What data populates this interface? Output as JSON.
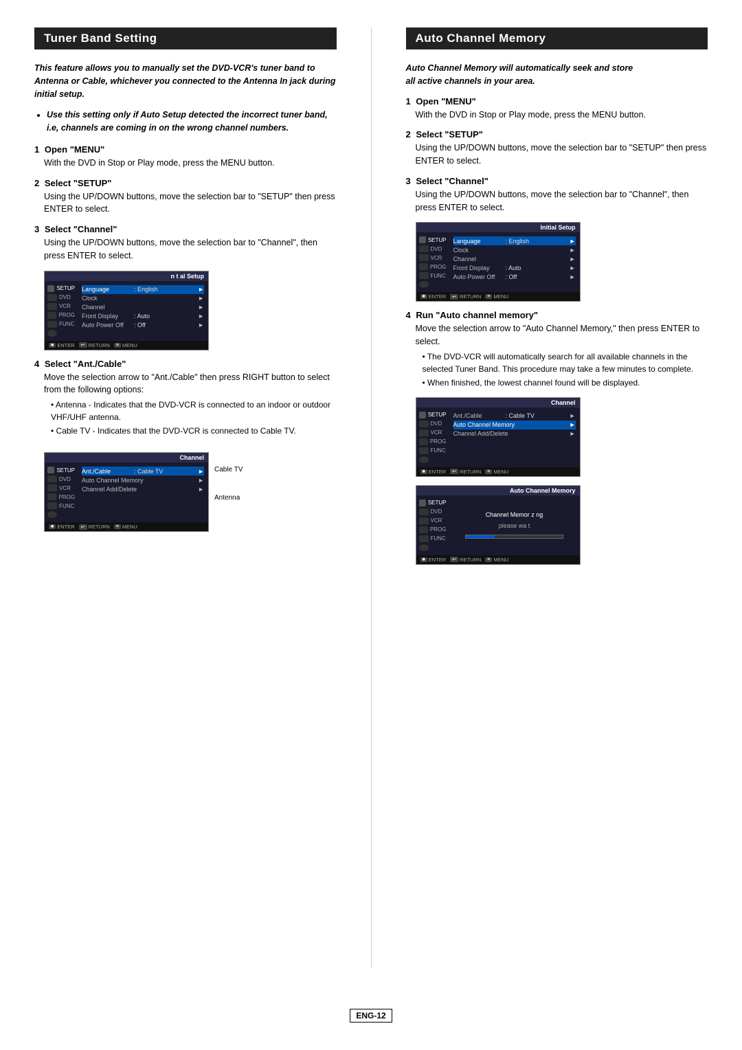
{
  "left": {
    "header": "Tuner Band Setting",
    "intro": "This feature allows you to manually set the DVD-VCR's tuner band to Antenna or Cable, whichever you connected to the Antenna In jack during initial setup.",
    "bullet": "Use this setting only if Auto Setup detected the incorrect tuner band, i.e, channels are coming in on the  wrong channel numbers.",
    "steps": [
      {
        "num": "1",
        "title": "Open \"MENU\"",
        "body": "With the DVD in Stop or Play mode, press the MENU button."
      },
      {
        "num": "2",
        "title": "Select \"SETUP\"",
        "body": "Using the UP/DOWN  buttons, move the selection bar to \"SETUP\" then press ENTER to select."
      },
      {
        "num": "3",
        "title": "Select \"Channel\"",
        "body": "Using the UP/DOWN buttons, move the selection bar to \"Channel\", then press ENTER to select."
      },
      {
        "num": "4",
        "title": "Select \"Ant./Cable\"",
        "body1": "Move the selection arrow to \"Ant./Cable\" then press RIGHT button to select from the following options:",
        "sub1": "• Antenna - Indicates that the DVD-VCR is connected to an indoor or outdoor VHF/UHF antenna.",
        "sub2": "• Cable TV - Indicates that the DVD-VCR is connected to Cable TV."
      }
    ],
    "screen1": {
      "title": "n t al Setup",
      "rows": [
        {
          "label": "Language",
          "value": ": English",
          "arrow": "►",
          "sidebar": "SETUP",
          "highlighted": false
        },
        {
          "label": "Clock",
          "value": "",
          "arrow": "►",
          "highlighted": false
        },
        {
          "label": "Channel",
          "value": "",
          "arrow": "►",
          "highlighted": false
        },
        {
          "label": "Front Display",
          "value": ": Auto",
          "arrow": "►",
          "highlighted": false
        },
        {
          "label": "Auto Power Off",
          "value": ": Off",
          "arrow": "►",
          "highlighted": false
        }
      ]
    },
    "screen2": {
      "title": "Channel",
      "rows": [
        {
          "label": "Ant./Cable",
          "value": ": Cable TV",
          "arrow": "►",
          "highlighted": true
        },
        {
          "label": "Auto Channel Memory",
          "value": "",
          "arrow": "►",
          "highlighted": false
        },
        {
          "label": "Channel Add/Delete",
          "value": "",
          "arrow": "►",
          "highlighted": false
        }
      ],
      "label1": "Cable TV",
      "label2": "Antenna"
    }
  },
  "right": {
    "header": "Auto Channel Memory",
    "intro1": "Auto Channel Memory will automatically seek and store",
    "intro2": "all active channels in your area.",
    "steps": [
      {
        "num": "1",
        "title": "Open \"MENU\"",
        "body": "With the DVD in Stop or Play mode, press the MENU button."
      },
      {
        "num": "2",
        "title": "Select \"SETUP\"",
        "body": "Using the UP/DOWN  buttons, move the selection bar to \"SETUP\" then press ENTER to select."
      },
      {
        "num": "3",
        "title": "Select \"Channel\"",
        "body": "Using the UP/DOWN buttons, move the selection bar to \"Channel\", then press ENTER to select."
      },
      {
        "num": "4",
        "title": "Run \"Auto channel memory\"",
        "body1": "Move the selection arrow to \"Auto Channel Memory,\" then press ENTER to select.",
        "sub1": "• The DVD-VCR will automatically search for all available channels in the selected Tuner Band. This procedure may take a few minutes to complete.",
        "sub2": "• When finished, the lowest channel found will be displayed."
      }
    ],
    "screen1": {
      "title": "Initial Setup",
      "rows": [
        {
          "label": "Language",
          "value": ": English",
          "arrow": "►"
        },
        {
          "label": "Clock",
          "value": "",
          "arrow": "►"
        },
        {
          "label": "Channel",
          "value": "",
          "arrow": "►"
        },
        {
          "label": "Front Display",
          "value": ": Auto",
          "arrow": "►"
        },
        {
          "label": "Auto Power Off",
          "value": ": Off",
          "arrow": "►"
        }
      ]
    },
    "screen2": {
      "title": "Channel",
      "rows": [
        {
          "label": "Ant./Cable",
          "value": ": Cable TV",
          "arrow": "►"
        },
        {
          "label": "Auto Channel Memory",
          "value": "",
          "arrow": "►",
          "highlighted": true
        },
        {
          "label": "Channel Add/Delete",
          "value": "",
          "arrow": "►"
        }
      ]
    },
    "screen3": {
      "title": "Auto Channel Memory",
      "message1": "Channel Memor z ng",
      "message2": "please  wa t"
    }
  },
  "footer": {
    "page_number": "ENG-12"
  }
}
